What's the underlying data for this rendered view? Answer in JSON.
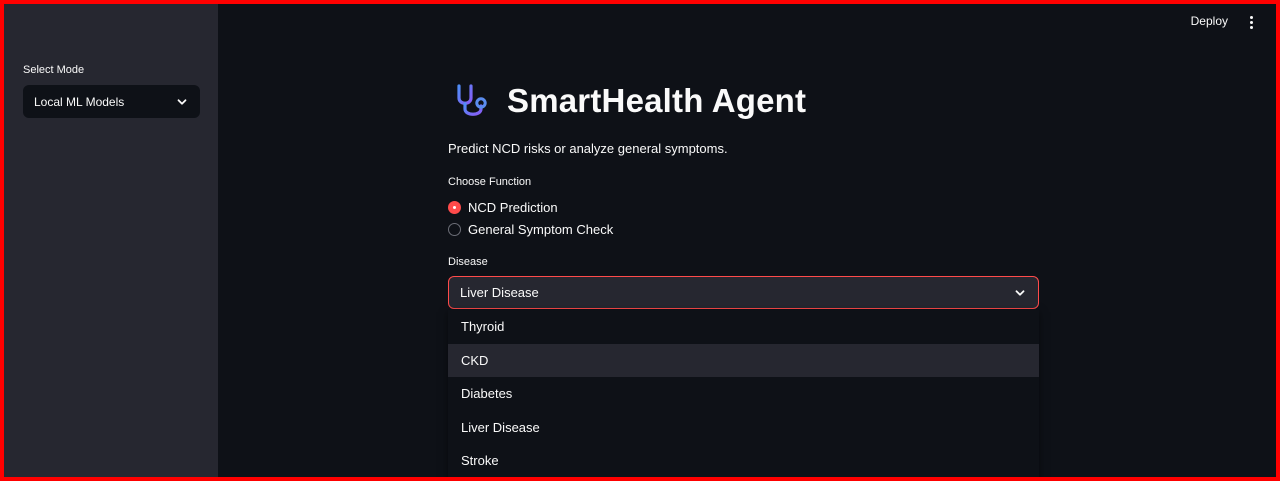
{
  "sidebar": {
    "mode_label": "Select Mode",
    "mode_value": "Local ML Models"
  },
  "header": {
    "deploy_label": "Deploy",
    "menu_icon": "kebab-menu-icon"
  },
  "main": {
    "logo_icon": "stethoscope-icon",
    "title": "SmartHealth Agent",
    "subtitle": "Predict NCD risks or analyze general symptoms.",
    "function_label": "Choose Function",
    "function_options": [
      {
        "label": "NCD Prediction",
        "selected": true
      },
      {
        "label": "General Symptom Check",
        "selected": false
      }
    ],
    "disease_label": "Disease",
    "disease_value": "Liver Disease",
    "disease_options": [
      {
        "label": "Thyroid",
        "highlighted": false
      },
      {
        "label": "CKD",
        "highlighted": true
      },
      {
        "label": "Diabetes",
        "highlighted": false
      },
      {
        "label": "Liver Disease",
        "highlighted": false
      },
      {
        "label": "Stroke",
        "highlighted": false
      }
    ]
  },
  "colors": {
    "accent": "#ff4b4b",
    "sidebar_bg": "#262730",
    "main_bg": "#0e1117",
    "frame": "#ff0000"
  }
}
